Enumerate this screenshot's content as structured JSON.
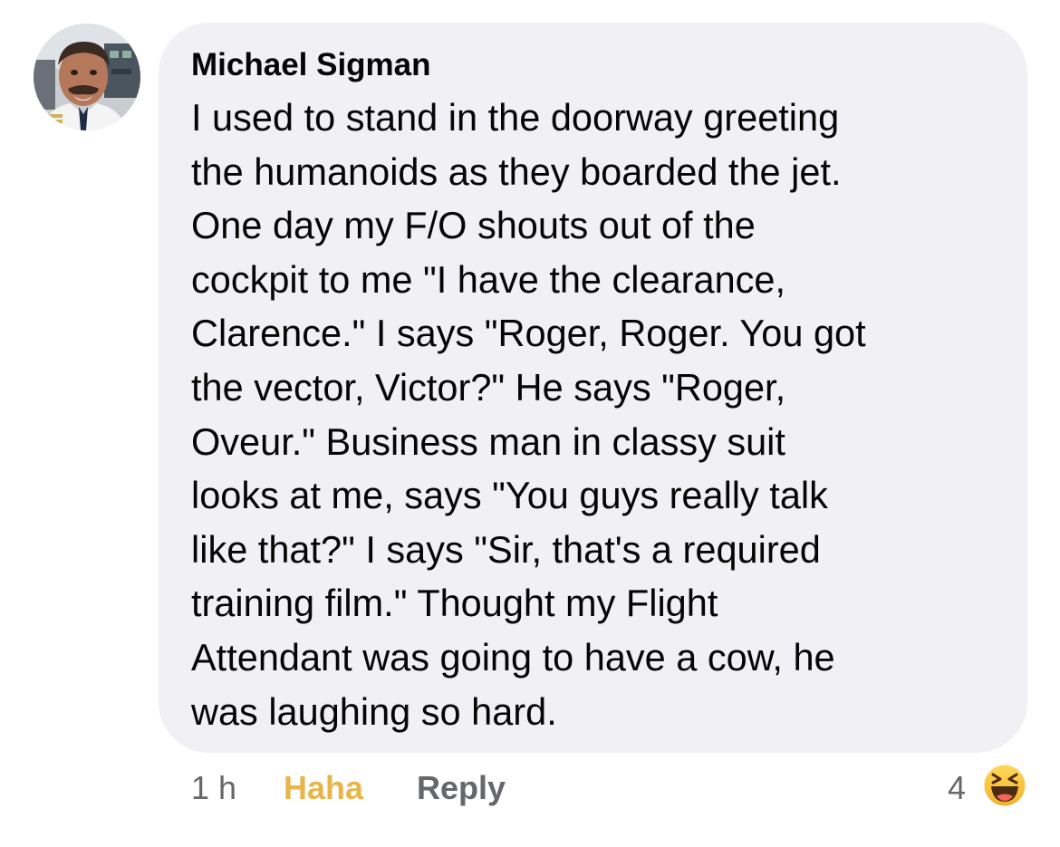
{
  "comment": {
    "author": "Michael Sigman",
    "text_lines": [
      "I used to stand in the doorway greeting",
      "the humanoids as they boarded the jet.",
      "One day my F/O shouts out of the",
      "cockpit to me \"I have the clearance,",
      "Clarence.\"  I says \"Roger, Roger.  You got",
      "the vector, Victor?\"  He says \"Roger,",
      "Oveur.\"  Business man in classy suit",
      "looks at me, says \"You guys really talk",
      "like that?\"  I says \"Sir, that's a required",
      "training film.\"  Thought my Flight",
      "Attendant was going to have a cow, he",
      "was laughing so hard."
    ],
    "avatar_icon": "profile-photo",
    "bubble_color": "#f0f0f5"
  },
  "actions": {
    "time": "1 h",
    "reaction_label": "Haha",
    "reaction_color": "#e8b54b",
    "reply_label": "Reply"
  },
  "reactions": {
    "count": "4",
    "icon": "haha-emoji-icon"
  }
}
